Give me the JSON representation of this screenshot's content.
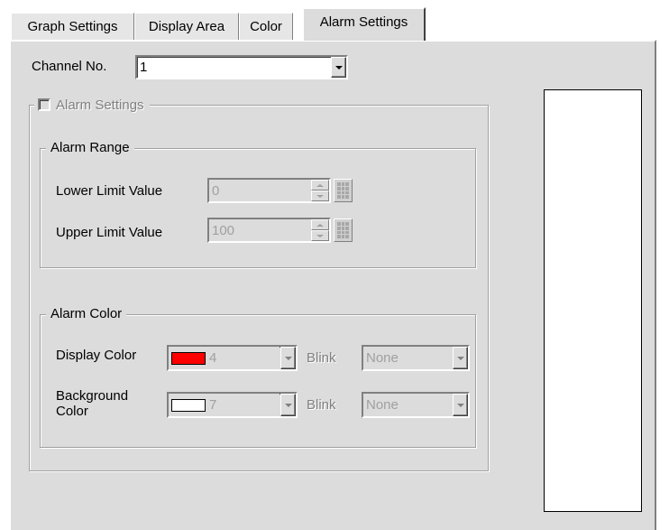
{
  "tabs": [
    {
      "label": "Graph Settings"
    },
    {
      "label": "Display Area"
    },
    {
      "label": "Color"
    },
    {
      "label": "Alarm Settings"
    }
  ],
  "channel": {
    "label": "Channel No.",
    "value": "1"
  },
  "alarm_settings": {
    "checkbox_label": "Alarm Settings",
    "checked": false
  },
  "alarm_range": {
    "title": "Alarm Range",
    "lower_label": "Lower Limit Value",
    "lower_value": "0",
    "upper_label": "Upper Limit Value",
    "upper_value": "100"
  },
  "alarm_color": {
    "title": "Alarm Color",
    "display_label": "Display Color",
    "display_value": "4",
    "display_swatch": "#ff0000",
    "blink_label_1": "Blink",
    "blink_value_1": "None",
    "background_label_1": "Background",
    "background_label_2": "Color",
    "background_value": "7",
    "background_swatch": "#ffffff",
    "blink_label_2": "Blink",
    "blink_value_2": "None"
  },
  "colors": {
    "panel": "#dcdcdc",
    "preview_bg": "#ffffff"
  }
}
